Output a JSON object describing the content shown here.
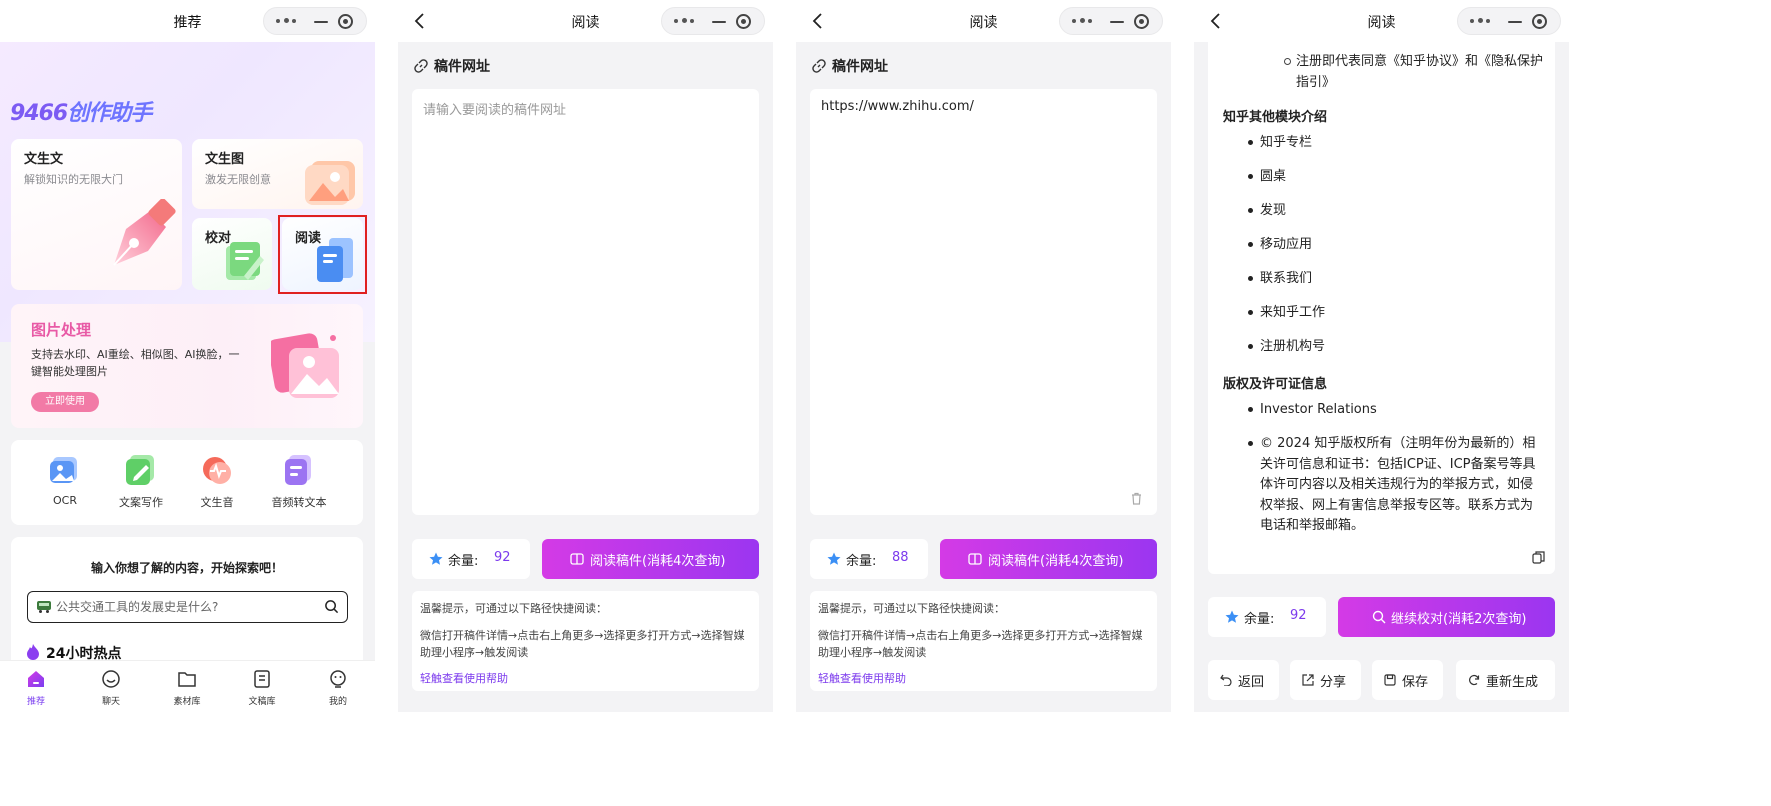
{
  "screen1": {
    "nav_title": "推荐",
    "brand": "9466创作助手",
    "cards": {
      "wensheng_wen": {
        "title": "文生文",
        "sub": "解锁知识的无限大门"
      },
      "wensheng_tu": {
        "title": "文生图",
        "sub": "激发无限创意"
      },
      "jiaodui": {
        "title": "校对"
      },
      "yuedu": {
        "title": "阅读"
      }
    },
    "image_processing": {
      "title": "图片处理",
      "desc": "支持去水印、AI重绘、相似图、AI换脸，一键智能处理图片",
      "button": "立即使用"
    },
    "tools": [
      {
        "label": "OCR",
        "icon": "ocr-icon"
      },
      {
        "label": "文案写作",
        "icon": "copywriting-icon"
      },
      {
        "label": "文生音",
        "icon": "text-to-audio-icon"
      },
      {
        "label": "音频转文本",
        "icon": "audio-to-text-icon"
      }
    ],
    "explore": {
      "title": "输入你想了解的内容，开始探索吧！",
      "placeholder": "公共交通工具的发展史是什么?",
      "hot_title": "24小时热点"
    },
    "tabbar": [
      {
        "label": "推荐",
        "active": true
      },
      {
        "label": "聊天",
        "active": false
      },
      {
        "label": "素材库",
        "active": false
      },
      {
        "label": "文稿库",
        "active": false
      },
      {
        "label": "我的",
        "active": false
      }
    ]
  },
  "screen2": {
    "nav_title": "阅读",
    "section_label": "稿件网址",
    "url_placeholder": "请输入要阅读的稿件网址",
    "url_value": "",
    "quota_label": "余量:",
    "quota_value": "92",
    "action_label": "阅读稿件(消耗4次查询)",
    "tips_title": "温馨提示，可通过以下路径快捷阅读：",
    "tips_body": "微信打开稿件详情→点击右上角更多→选择更多打开方式→选择智媒助理小程序→触发阅读",
    "tips_link": "轻触查看使用帮助"
  },
  "screen3": {
    "nav_title": "阅读",
    "section_label": "稿件网址",
    "url_placeholder": "请输入要阅读的稿件网址",
    "url_value": "https://www.zhihu.com/",
    "quota_label": "余量:",
    "quota_value": "88",
    "action_label": "阅读稿件(消耗4次查询)",
    "tips_title": "温馨提示，可通过以下路径快捷阅读：",
    "tips_body": "微信打开稿件详情→点击右上角更多→选择更多打开方式→选择智媒助理小程序→触发阅读",
    "tips_link": "轻触查看使用帮助"
  },
  "screen4": {
    "nav_title": "阅读",
    "result": {
      "sub_item": "注册即代表同意《知乎协议》和《隐私保护指引》",
      "heading1": "知乎其他模块介绍",
      "list1": [
        "知乎专栏",
        "圆桌",
        "发现",
        "移动应用",
        "联系我们",
        "来知乎工作",
        "注册机构号"
      ],
      "heading2": "版权及许可证信息",
      "list2": [
        "Investor Relations",
        "© 2024 知乎版权所有（注明年份为最新的）相关许可信息和证书：包括ICP证、ICP备案号等具体许可内容以及相关违规行为的举报方式，如侵权举报、网上有害信息举报专区等。联系方式为电话和举报邮箱。"
      ]
    },
    "quota_label": "余量:",
    "quota_value": "92",
    "action_label": "继续校对(消耗2次查询)",
    "buttons": [
      "返回",
      "分享",
      "保存",
      "重新生成"
    ]
  },
  "colors": {
    "accent": "#7c3aed",
    "gradient_start": "#d43ae6",
    "gradient_end": "#9b36f0",
    "highlight_box": "#e02020"
  }
}
